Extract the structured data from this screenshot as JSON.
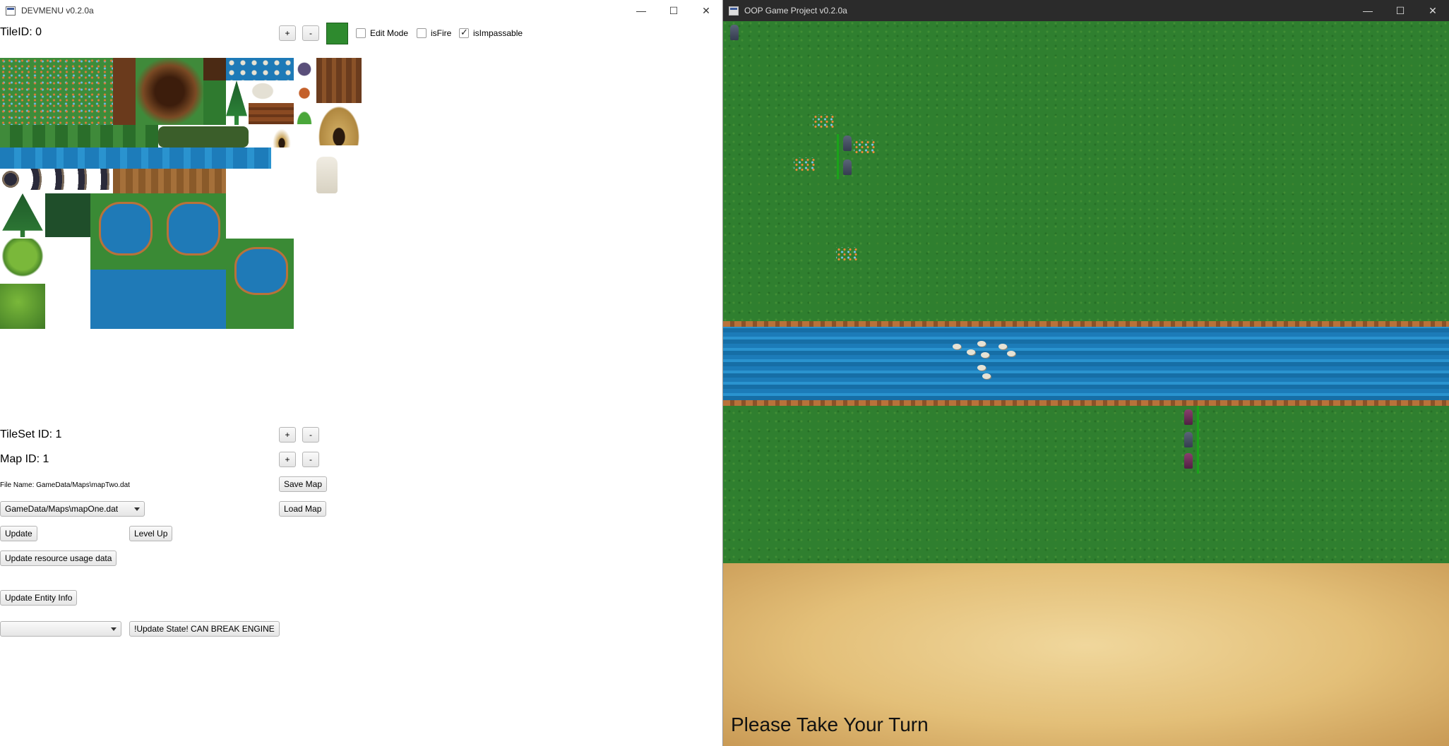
{
  "devmenu": {
    "title": "DEVMENU v0.2.0a",
    "tile_id_label": "TileID: 0",
    "plus": "+",
    "minus": "-",
    "edit_mode_label": "Edit Mode",
    "is_fire_label": "isFire",
    "is_impassable_label": "isImpassable",
    "edit_mode_checked": false,
    "is_fire_checked": false,
    "is_impassable_checked": true,
    "tileset_id_label": "TileSet ID: 1",
    "map_id_label": "Map ID: 1",
    "file_name_label": "File Name: GameData/Maps\\mapTwo.dat",
    "save_map": "Save Map",
    "load_map": "Load Map",
    "map_select_value": "GameData/Maps\\mapOne.dat",
    "update": "Update",
    "level_up": "Level Up",
    "update_resource": "Update resource usage data",
    "update_entity": "Update Entity Info",
    "state_select_value": "",
    "update_state": "!Update State! CAN BREAK ENGINE"
  },
  "window_controls": {
    "minimize": "—",
    "maximize": "☐",
    "close": "✕"
  },
  "game": {
    "title": "OOP Game Project v0.2.0a",
    "status_text": "Please Take Your Turn"
  }
}
